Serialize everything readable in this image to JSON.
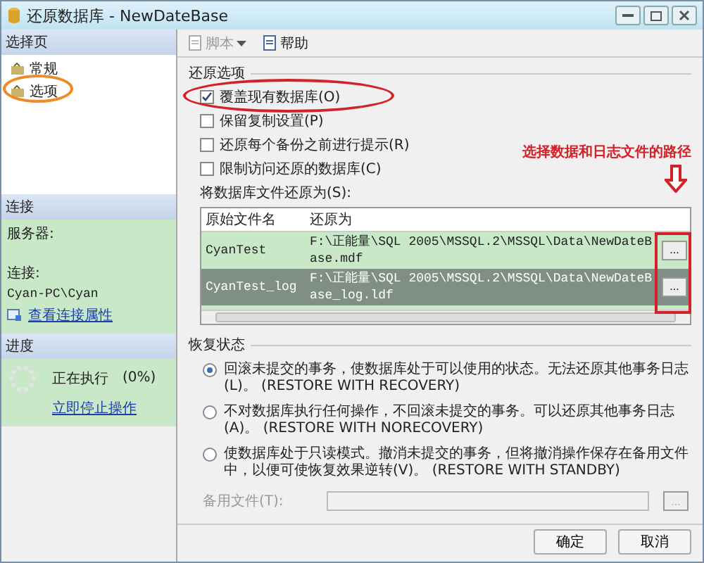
{
  "window": {
    "title": "还原数据库 - NewDateBase"
  },
  "sidebar": {
    "header": "选择页",
    "items": [
      {
        "label": "常规"
      },
      {
        "label": "选项"
      }
    ]
  },
  "connection": {
    "header": "连接",
    "server_label": "服务器:",
    "connection_label": "连接:",
    "connection_value": "Cyan-PC\\Cyan",
    "link": "查看连接属性"
  },
  "progress": {
    "header": "进度",
    "status": "正在执行",
    "percent": "(0%)",
    "link": "立即停止操作"
  },
  "toolbar": [
    {
      "label": "脚本",
      "disabled": true,
      "dropdown": true
    },
    {
      "label": "帮助",
      "disabled": false,
      "dropdown": false
    }
  ],
  "restore_options": {
    "title": "还原选项",
    "checkboxes": [
      {
        "label": "覆盖现有数据库(O)",
        "checked": true
      },
      {
        "label": "保留复制设置(P)",
        "checked": false
      },
      {
        "label": "还原每个备份之前进行提示(R)",
        "checked": false
      },
      {
        "label": "限制访问还原的数据库(C)",
        "checked": false
      }
    ]
  },
  "files": {
    "label": "将数据库文件还原为(S):",
    "columns": [
      "原始文件名",
      "还原为"
    ],
    "rows": [
      {
        "name": "CyanTest",
        "path": "F:\\正能量\\SQL 2005\\MSSQL.2\\MSSQL\\Data\\NewDateBase.mdf",
        "button": "...",
        "selected": false
      },
      {
        "name": "CyanTest_log",
        "path": "F:\\正能量\\SQL 2005\\MSSQL.2\\MSSQL\\Data\\NewDateBase_log.ldf",
        "button": "...",
        "selected": true
      }
    ]
  },
  "recovery": {
    "title": "恢复状态",
    "options": [
      {
        "label": "回滚未提交的事务，使数据库处于可以使用的状态。无法还原其他事务日志(L)。 (RESTORE WITH RECOVERY)",
        "selected": true
      },
      {
        "label": "不对数据库执行任何操作，不回滚未提交的事务。可以还原其他事务日志(A)。 (RESTORE WITH NORECOVERY)",
        "selected": false
      },
      {
        "label": "使数据库处于只读模式。撤消未提交的事务，但将撤消操作保存在备用文件中，以便可使恢复效果逆转(V)。 (RESTORE WITH STANDBY)",
        "selected": false
      }
    ],
    "standby_label": "备用文件(T):",
    "standby_disabled": true,
    "standby_button": "..."
  },
  "buttons": [
    "确定",
    "取消"
  ],
  "annotation": {
    "text": "选择数据和日志文件的路径"
  }
}
